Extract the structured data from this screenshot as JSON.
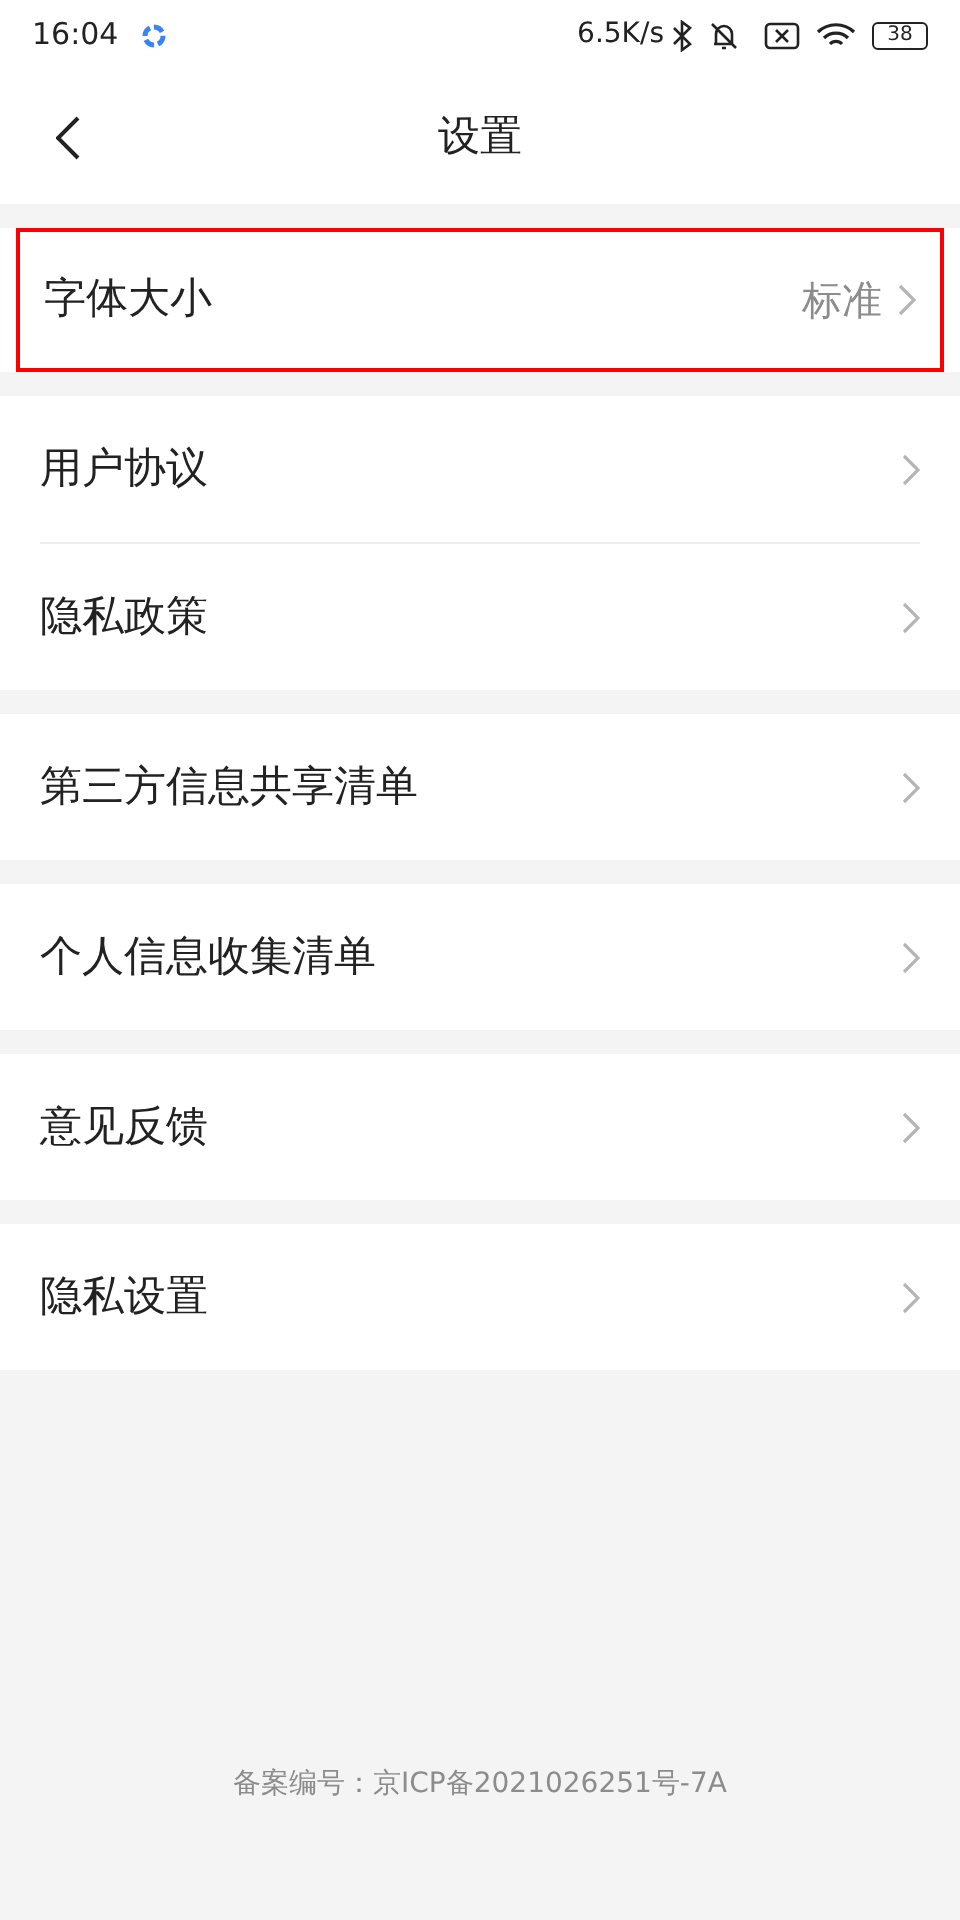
{
  "status_bar": {
    "time": "16:04",
    "speed": "6.5K/s",
    "battery": "38"
  },
  "header": {
    "title": "设置"
  },
  "groups": [
    {
      "items": [
        {
          "label": "字体大小",
          "value": "标准",
          "highlighted": true
        }
      ]
    },
    {
      "items": [
        {
          "label": "用户协议",
          "highlighted": false
        },
        {
          "label": "隐私政策",
          "highlighted": false
        }
      ]
    },
    {
      "items": [
        {
          "label": "第三方信息共享清单",
          "highlighted": false
        }
      ]
    },
    {
      "items": [
        {
          "label": "个人信息收集清单",
          "highlighted": false
        }
      ]
    },
    {
      "items": [
        {
          "label": "意见反馈",
          "highlighted": false
        }
      ]
    },
    {
      "items": [
        {
          "label": "隐私设置",
          "highlighted": false
        }
      ]
    }
  ],
  "footer": {
    "text": "备案编号：京ICP备2021026251号-7A"
  }
}
